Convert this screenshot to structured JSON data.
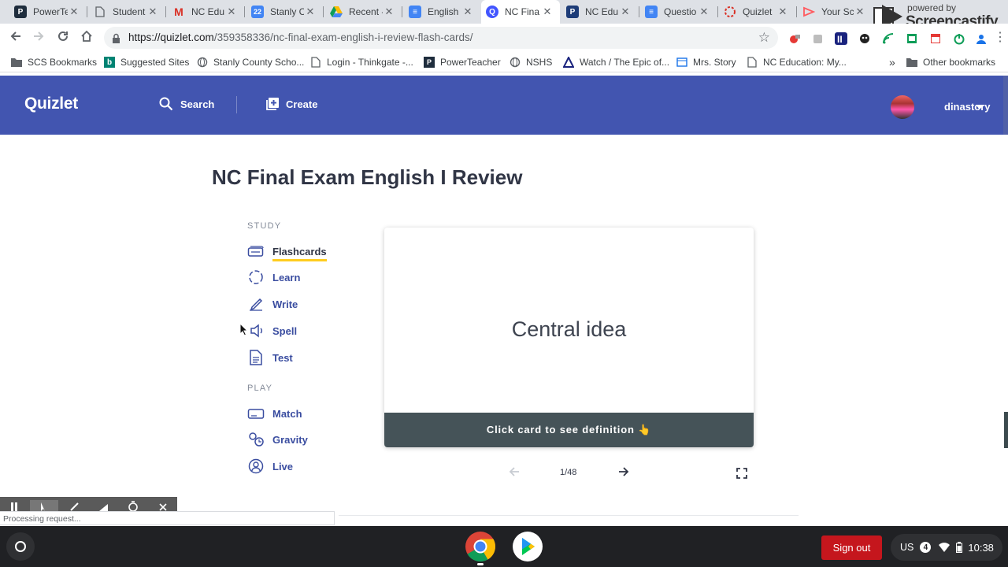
{
  "browser": {
    "tabs": [
      {
        "title": "PowerTe",
        "icon": "powerteacher-icon",
        "color": "#1f2d3d",
        "active": false
      },
      {
        "title": "Student",
        "icon": "document-icon",
        "color": "#5f6368",
        "active": false
      },
      {
        "title": "NC Edu",
        "icon": "gmail-icon",
        "color": "#d93025",
        "active": false
      },
      {
        "title": "Stanly C",
        "icon": "calendar-icon",
        "color": "#4285f4",
        "active": false
      },
      {
        "title": "Recent -",
        "icon": "drive-icon",
        "color": "#0f9d58",
        "active": false
      },
      {
        "title": "English",
        "icon": "google-docs-icon",
        "color": "#4285f4",
        "active": false
      },
      {
        "title": "NC Fina",
        "icon": "quizlet-icon",
        "color": "#4255ff",
        "active": true
      },
      {
        "title": "NC Edu",
        "icon": "powerschool-icon",
        "color": "#1d3c78",
        "active": false
      },
      {
        "title": "Questio",
        "icon": "google-docs-icon",
        "color": "#4285f4",
        "active": false
      },
      {
        "title": "Quizlet",
        "icon": "loading-icon",
        "color": "#d93025",
        "active": false
      },
      {
        "title": "Your Sc",
        "icon": "screencastify-icon",
        "color": "#ff5a5f",
        "active": false
      }
    ],
    "screencastify_banner": {
      "line1": "powered by",
      "line2": "Screencastify"
    },
    "url": {
      "host": "https://quizlet.com",
      "path": "/359358336/nc-final-exam-english-i-review-flash-cards/"
    },
    "bookmarks": [
      {
        "label": "SCS Bookmarks",
        "icon": "folder-icon"
      },
      {
        "label": "Suggested Sites",
        "icon": "bing-icon"
      },
      {
        "label": "Stanly County Scho...",
        "icon": "globe-icon"
      },
      {
        "label": "Login - Thinkgate -...",
        "icon": "page-icon"
      },
      {
        "label": "PowerTeacher",
        "icon": "powerteacher-icon"
      },
      {
        "label": "NSHS",
        "icon": "globe-icon"
      },
      {
        "label": "Watch / The Epic of...",
        "icon": "watch-icon"
      },
      {
        "label": "Mrs. Story",
        "icon": "classroom-icon"
      },
      {
        "label": "NC Education: My...",
        "icon": "page-icon"
      }
    ],
    "overflow_label": "»",
    "other_bookmarks": "Other bookmarks"
  },
  "quizlet": {
    "logo": "Quizlet",
    "search_label": "Search",
    "create_label": "Create",
    "username": "dinastory",
    "brand_color": "#4255b0"
  },
  "page": {
    "title": "NC Final Exam English I Review",
    "study_label": "STUDY",
    "study_modes": [
      {
        "label": "Flashcards",
        "icon": "flashcards-icon",
        "active": true
      },
      {
        "label": "Learn",
        "icon": "learn-icon",
        "active": false
      },
      {
        "label": "Write",
        "icon": "write-icon",
        "active": false
      },
      {
        "label": "Spell",
        "icon": "spell-icon",
        "active": false
      },
      {
        "label": "Test",
        "icon": "test-icon",
        "active": false
      }
    ],
    "play_label": "PLAY",
    "play_modes": [
      {
        "label": "Match",
        "icon": "match-icon"
      },
      {
        "label": "Gravity",
        "icon": "gravity-icon"
      },
      {
        "label": "Live",
        "icon": "live-icon"
      }
    ],
    "card": {
      "term": "Central idea",
      "footer": "Click card to see definition 👆"
    },
    "counter": "1/48"
  },
  "status": {
    "text": "Processing request..."
  },
  "shelf": {
    "signout_label": "Sign out",
    "locale": "US",
    "notification_count": "4",
    "time": "10:38",
    "signout_color": "#c5161d"
  }
}
